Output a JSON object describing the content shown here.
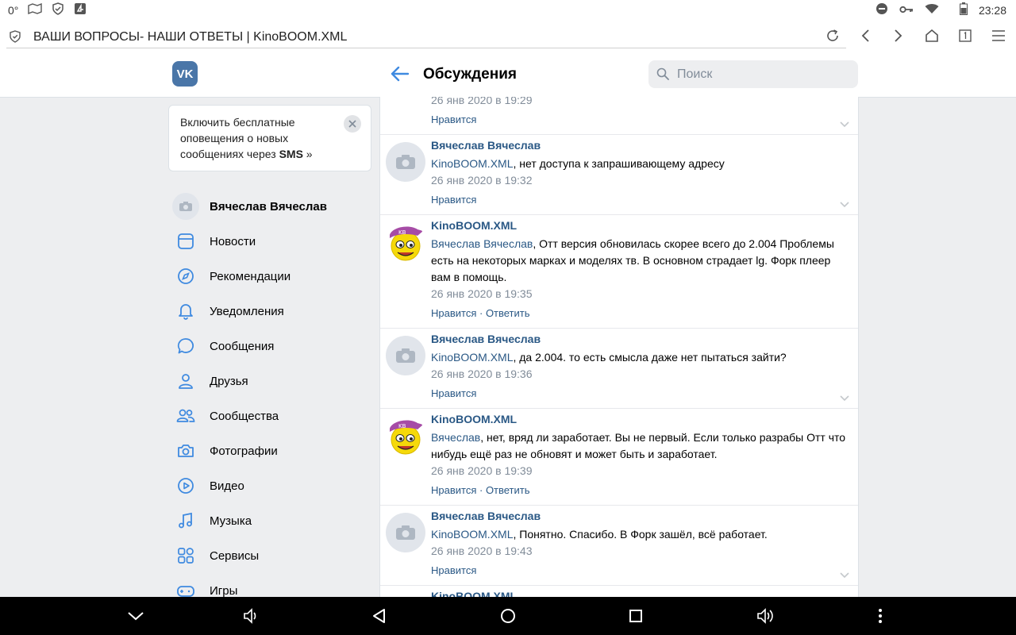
{
  "status_bar": {
    "temperature": "0°",
    "time": "23:28"
  },
  "browser": {
    "page_title": "ВАШИ ВОПРОСЫ- НАШИ ОТВЕТЫ | KinoBOOM.XML"
  },
  "vk_header": {
    "logo_text": "VK",
    "title": "Обсуждения",
    "search_placeholder": "Поиск"
  },
  "sms_card": {
    "text_before": "Включить бесплатные оповещения о новых сообщениях через ",
    "text_bold": "SMS",
    "text_after": " »"
  },
  "nav": {
    "profile_name": "Вячеслав Вячеслав",
    "items": [
      {
        "label": "Новости",
        "icon": "news-icon"
      },
      {
        "label": "Рекомендации",
        "icon": "compass-icon"
      },
      {
        "label": "Уведомления",
        "icon": "bell-icon"
      },
      {
        "label": "Сообщения",
        "icon": "chat-icon"
      },
      {
        "label": "Друзья",
        "icon": "user-icon"
      },
      {
        "label": "Сообщества",
        "icon": "group-icon"
      },
      {
        "label": "Фотографии",
        "icon": "camera-icon"
      },
      {
        "label": "Видео",
        "icon": "play-icon"
      },
      {
        "label": "Музыка",
        "icon": "music-icon"
      },
      {
        "label": "Сервисы",
        "icon": "apps-icon"
      },
      {
        "label": "Игры",
        "icon": "gamepad-icon"
      }
    ]
  },
  "comments": {
    "c0": {
      "date": "26 янв 2020 в 19:29",
      "like": "Нравится"
    },
    "c1": {
      "author": "Вячеслав Вячеслав",
      "mention": "KinoBOOM.XML",
      "text": ", нет доступа к запрашивающему адресу",
      "date": "26 янв 2020 в 19:32",
      "like": "Нравится"
    },
    "c2": {
      "author": "KinoBOOM.XML",
      "mention": "Вячеслав Вячеслав",
      "text": ", Отт версия обновилась скорее всего до 2.004 Проблемы есть на некоторых марках и моделях тв. В основном страдает lg. Форк плеер вам в помощь.",
      "date": "26 янв 2020 в 19:35",
      "like": "Нравится",
      "sep": " · ",
      "reply": "Ответить"
    },
    "c3": {
      "author": "Вячеслав Вячеслав",
      "mention": "KinoBOOM.XML",
      "text": ", да 2.004. то есть смысла даже нет пытаться зайти?",
      "date": "26 янв 2020 в 19:36",
      "like": "Нравится"
    },
    "c4": {
      "author": "KinoBOOM.XML",
      "mention": "Вячеслав",
      "text": ", нет, вряд ли заработает. Вы не первый. Если только разрабы Отт что нибудь ещё раз не обновят и может быть и заработает.",
      "date": "26 янв 2020 в 19:39",
      "like": "Нравится",
      "sep": " · ",
      "reply": "Ответить"
    },
    "c5": {
      "author": "Вячеслав Вячеслав",
      "mention": "KinoBOOM.XML",
      "text": ", Понятно. Спасибо. В Форк зашёл, всё работает.",
      "date": "26 янв 2020 в 19:43",
      "like": "Нравится"
    },
    "c6": {
      "author": "KinoBOOM.XML"
    }
  },
  "colors": {
    "vk_blue": "#4a76a8",
    "link": "#2a5885",
    "accent_icon": "#3f8ae0",
    "meta": "#818c99"
  }
}
